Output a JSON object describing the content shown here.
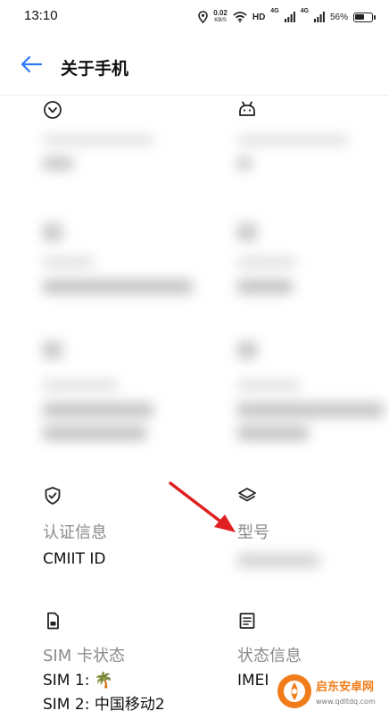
{
  "status_bar": {
    "time": "13:10",
    "net_speed_value": "0.02",
    "net_speed_unit": "KB/S",
    "hd_label": "HD",
    "signal_label_1": "4G",
    "signal_label_2": "4G",
    "battery_percent": "56%",
    "battery_level": 0.56
  },
  "header": {
    "title": "关于手机"
  },
  "cells": {
    "certification": {
      "label": "认证信息",
      "value": "CMIIT ID"
    },
    "model": {
      "label": "型号"
    },
    "sim_status": {
      "label": "SIM 卡状态",
      "sim1": "SIM 1: 🌴",
      "sim2": "SIM 2: 中国移动2"
    },
    "status_info": {
      "label": "状态信息",
      "value": "IMEI"
    }
  },
  "watermark": {
    "name": "启东安卓网",
    "url": "www.qdltdq.com"
  },
  "colors": {
    "arrow": "#e02020",
    "label_gray": "#8a8a8a",
    "accent_blue": "#2f7bf6",
    "watermark_orange": "#f07d1a"
  }
}
